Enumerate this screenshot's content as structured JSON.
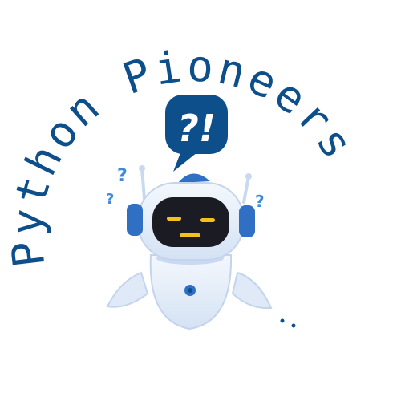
{
  "logo": {
    "title": "Python Pioneers",
    "colors": {
      "brand_blue": "#0c4f8b",
      "robot_body": "#e6eef9",
      "robot_shade": "#c9d9f0",
      "robot_accent": "#2f6fc4",
      "face_screen": "#1b1b24",
      "face_eyes": "#f2c21a",
      "question_marks": "#3f8ad8"
    },
    "bubble_text": "?!",
    "question_mark": "?",
    "icons": [
      "robot-icon",
      "speech-bubble-icon",
      "question-mark-icon"
    ]
  }
}
